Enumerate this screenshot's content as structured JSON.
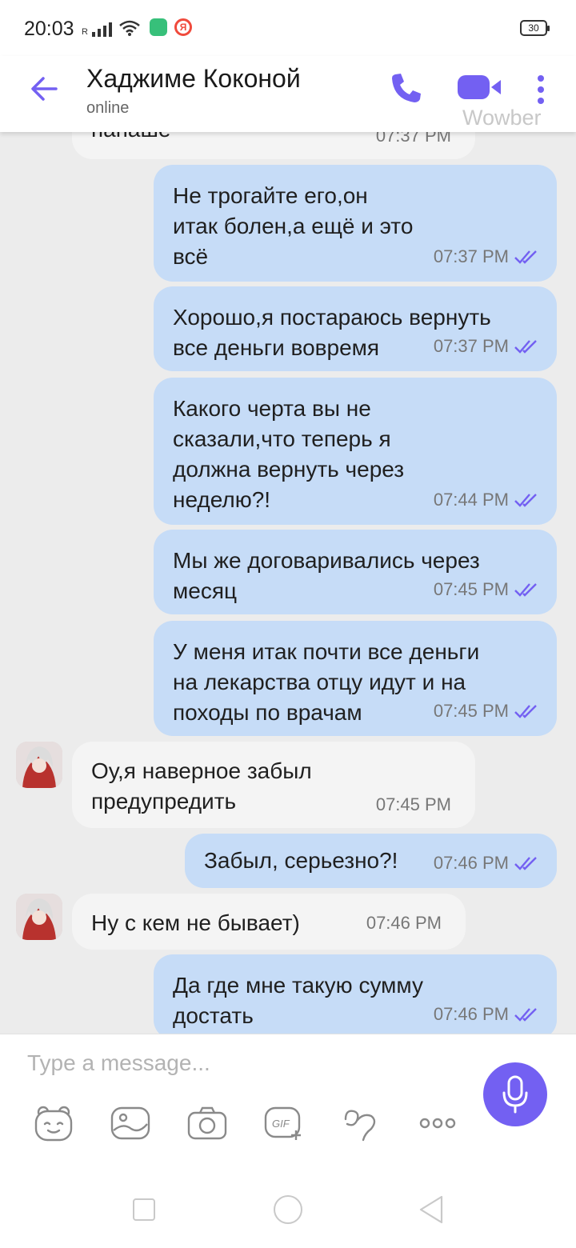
{
  "status_bar": {
    "time": "20:03",
    "signal_label": "R",
    "battery": "30"
  },
  "header": {
    "title": "Хаджиме Коконой",
    "status": "online",
    "watermark": "Wowber",
    "colors": {
      "accent": "#7360f2"
    }
  },
  "messages": [
    {
      "dir": "in",
      "text": "папаше",
      "time": "07:37 PM"
    },
    {
      "dir": "out",
      "text": "Не трогайте его,он\nитак болен,а ещё и это\nвсё",
      "time": "07:37 PM"
    },
    {
      "dir": "out",
      "text": "Хорошо,я постараюсь вернуть\nвсе деньги вовремя",
      "time": "07:37 PM"
    },
    {
      "dir": "out",
      "text": "Какого черта вы не\nсказали,что теперь я\nдолжна вернуть через\nнеделю?!",
      "time": "07:44 PM"
    },
    {
      "dir": "out",
      "text": "Мы же договаривались через\nмесяц",
      "time": "07:45 PM"
    },
    {
      "dir": "out",
      "text": "У меня итак почти все деньги\nна лекарства отцу идут и на\nпоходы по врачам",
      "time": "07:45 PM"
    },
    {
      "dir": "in",
      "text": "Оу,я наверное забыл\nпредупредить",
      "time": "07:45 PM"
    },
    {
      "dir": "out",
      "text": "Забыл, серьезно?!",
      "time": "07:46 PM"
    },
    {
      "dir": "in",
      "text": "Ну с кем не бывает)",
      "time": "07:46 PM"
    },
    {
      "dir": "out",
      "text": "Да где мне такую сумму\nдостать",
      "time": "07:46 PM"
    }
  ],
  "composer": {
    "placeholder": "Type a message...",
    "tools": [
      "sticker-icon",
      "gallery-icon",
      "camera-icon",
      "gif-icon",
      "doodle-icon",
      "more-options-icon"
    ]
  },
  "colors": {
    "outgoing_bubble": "#c6dcf7",
    "incoming_bubble": "#f4f4f4",
    "chat_background": "#ececec",
    "read_ticks": "#7360f2"
  }
}
